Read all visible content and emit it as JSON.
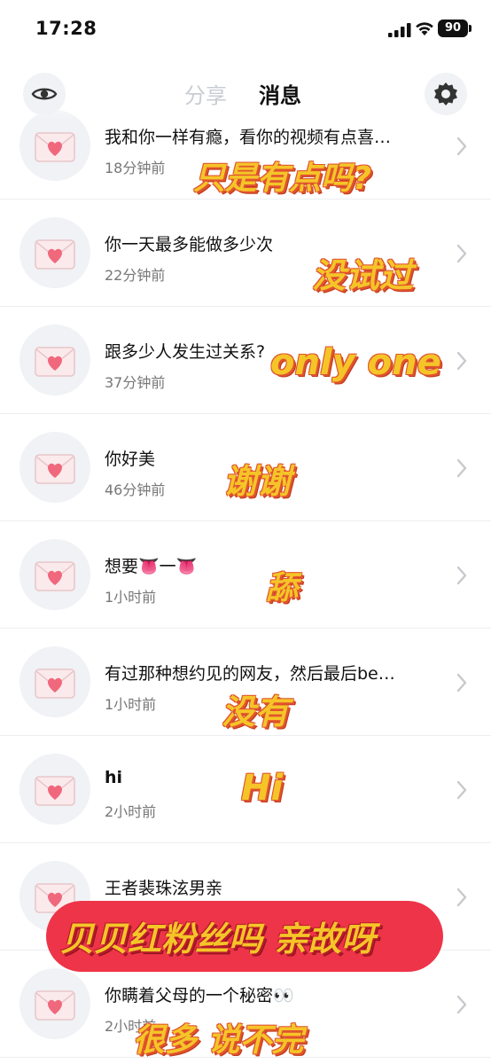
{
  "status_bar": {
    "time": "17:28",
    "battery": "90"
  },
  "header": {
    "tab_share": "分享",
    "tab_messages": "消息"
  },
  "messages": [
    {
      "title": "我和你一样有瘾，看你的视频有点喜…",
      "time": "18分钟前",
      "reply": "只是有点吗?"
    },
    {
      "title": "你一天最多能做多少次",
      "time": "22分钟前",
      "reply": "没试过"
    },
    {
      "title": "跟多少人发生过关系?",
      "time": "37分钟前",
      "reply": "only one"
    },
    {
      "title": "你好美",
      "time": "46分钟前",
      "reply": "谢谢"
    },
    {
      "title": "想要👅一👅",
      "time": "1小时前",
      "reply": "舔"
    },
    {
      "title": "有过那种想约见的网友，然后最后be…",
      "time": "1小时前",
      "reply": "没有"
    },
    {
      "title": "hi",
      "time": "2小时前",
      "reply": "Hi"
    },
    {
      "title": "王者裴珠泫男亲",
      "time": "",
      "reply": "贝贝红粉丝吗 亲故呀"
    },
    {
      "title": "你瞒着父母的一个秘密👀",
      "time": "2小时前",
      "reply": "很多 说不完"
    }
  ],
  "colors": {
    "overlay_text": "#f5c528",
    "overlay_outline": "#e0542e",
    "pill": "#ee3448",
    "avatar_bg": "#f0f2f5"
  }
}
